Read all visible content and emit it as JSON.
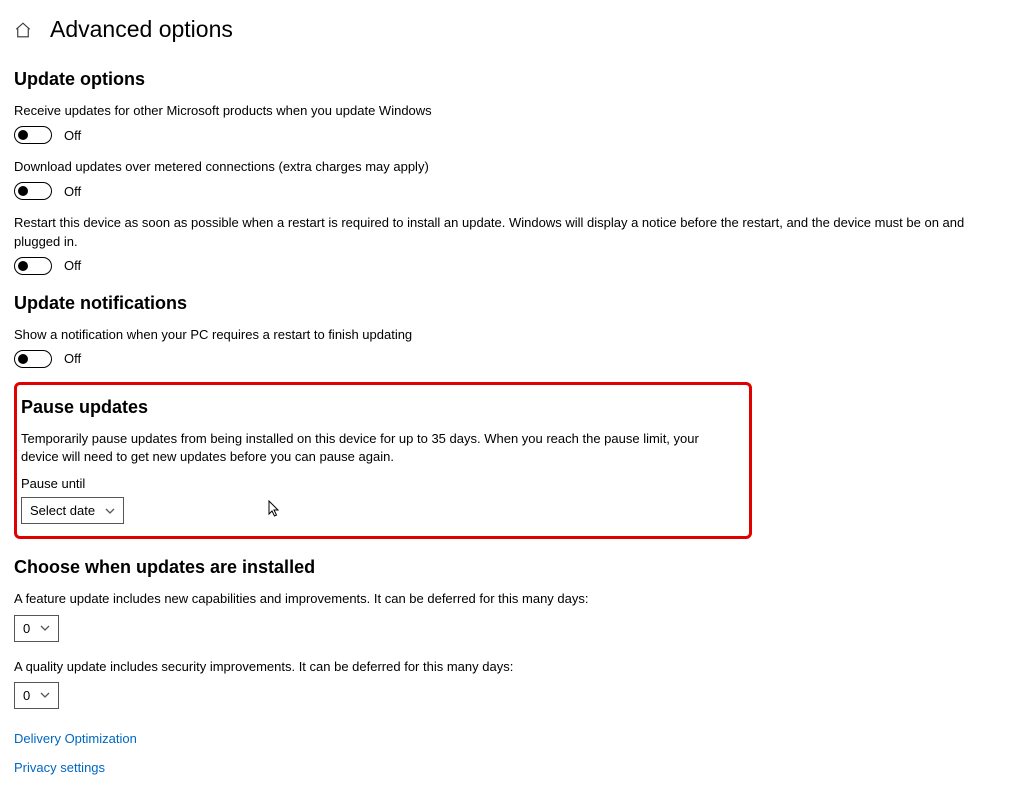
{
  "header": {
    "title": "Advanced options"
  },
  "sections": {
    "update_options": {
      "heading": "Update options",
      "opt1": {
        "desc": "Receive updates for other Microsoft products when you update Windows",
        "state": "Off"
      },
      "opt2": {
        "desc": "Download updates over metered connections (extra charges may apply)",
        "state": "Off"
      },
      "opt3": {
        "desc": "Restart this device as soon as possible when a restart is required to install an update. Windows will display a notice before the restart, and the device must be on and plugged in.",
        "state": "Off"
      }
    },
    "update_notifications": {
      "heading": "Update notifications",
      "opt1": {
        "desc": "Show a notification when your PC requires a restart to finish updating",
        "state": "Off"
      }
    },
    "pause_updates": {
      "heading": "Pause updates",
      "desc": "Temporarily pause updates from being installed on this device for up to 35 days. When you reach the pause limit, your device will need to get new updates before you can pause again.",
      "label": "Pause until",
      "select_value": "Select date"
    },
    "choose_when": {
      "heading": "Choose when updates are installed",
      "feature_desc": "A feature update includes new capabilities and improvements. It can be deferred for this many days:",
      "feature_value": "0",
      "quality_desc": "A quality update includes security improvements. It can be deferred for this many days:",
      "quality_value": "0"
    },
    "links": {
      "delivery": "Delivery Optimization",
      "privacy": "Privacy settings"
    }
  }
}
